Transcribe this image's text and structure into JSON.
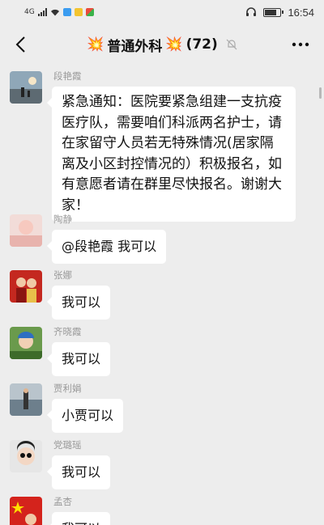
{
  "status_bar": {
    "signal_label": "4G",
    "time": "16:54"
  },
  "header": {
    "title": "普通外科",
    "member_count": "(72)",
    "title_emoji": "💥"
  },
  "messages": [
    {
      "sender": "段艳霞",
      "text": "紧急通知：医院要紧急组建一支抗疫医疗队，需要咱们科派两名护士，请在家留守人员若无特殊情况(居家隔离及小区封控情况的）积极报名，如有意愿者请在群里尽快报名。谢谢大家！"
    },
    {
      "sender": "陶静",
      "text": "@段艳霞  我可以"
    },
    {
      "sender": "张娜",
      "text": "我可以"
    },
    {
      "sender": "齐晓霞",
      "text": "我可以"
    },
    {
      "sender": "贾利娟",
      "text": "小贾可以"
    },
    {
      "sender": "党璐瑶",
      "text": "我可以"
    },
    {
      "sender": "孟杏",
      "text": "我可以"
    }
  ],
  "icons": {
    "back": "back-arrow-icon",
    "more": "more-dots-icon",
    "mute": "mute-bell-icon"
  },
  "colors": {
    "background": "#ededed",
    "bubble": "#ffffff",
    "sender_name": "#999999"
  }
}
